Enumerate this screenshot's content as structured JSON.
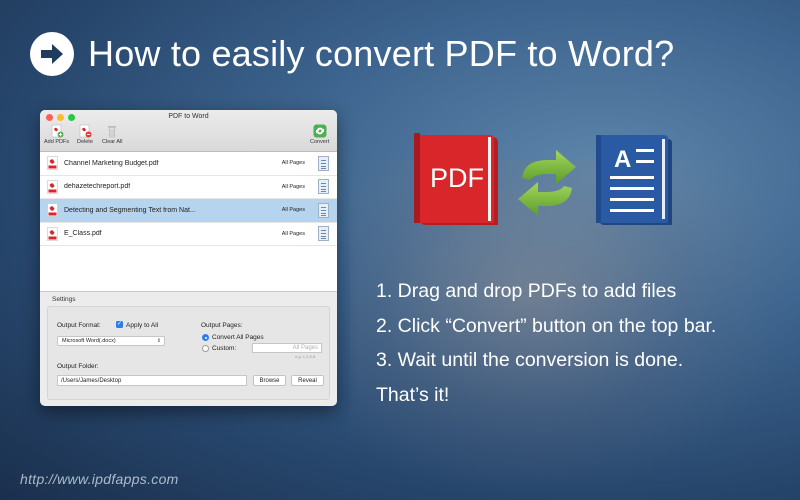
{
  "headline": "How to easily convert PDF to Word?",
  "window": {
    "title": "PDF to Word",
    "toolbar": {
      "add_pdfs": "Add PDFs",
      "delete": "Delete",
      "clear_all": "Clear All",
      "convert": "Convert"
    },
    "files": [
      {
        "name": "Channel Marketing Budget.pdf",
        "pages": "All Pages",
        "selected": false
      },
      {
        "name": "dehazetechreport.pdf",
        "pages": "All Pages",
        "selected": false
      },
      {
        "name": "Detecting and Segmenting Text from Nat...",
        "pages": "All Pages",
        "selected": true
      },
      {
        "name": "E_Class.pdf",
        "pages": "All Pages",
        "selected": false
      }
    ],
    "settings": {
      "section_label": "Settings",
      "output_format_label": "Output Format:",
      "apply_to_all_label": "Apply to All",
      "apply_to_all_checked": true,
      "format_value": "Microsoft Word(.docx)",
      "output_pages_label": "Output Pages:",
      "convert_all_label": "Convert All Pages",
      "custom_label": "Custom:",
      "custom_placeholder": "All Pages",
      "custom_hint": "e.g. 1,3,5-8",
      "output_folder_label": "Output Folder:",
      "folder_value": "/Users/James/Desktop",
      "browse_label": "Browse",
      "reveal_label": "Reveal"
    }
  },
  "illustration": {
    "pdf_label": "PDF",
    "word_letter": "A"
  },
  "steps": [
    "1. Drag and drop PDFs to add files",
    "2. Click “Convert” button on the top bar.",
    "3. Wait until the conversion is done.",
    "That’s it!"
  ],
  "url": "http://www.ipdfapps.com",
  "colors": {
    "accent_blue": "#2d7cf0",
    "pdf_red": "#d8262b",
    "word_blue": "#2b5aa5",
    "swap_green": "#7cbf3a",
    "selection": "#b6d4ee"
  }
}
